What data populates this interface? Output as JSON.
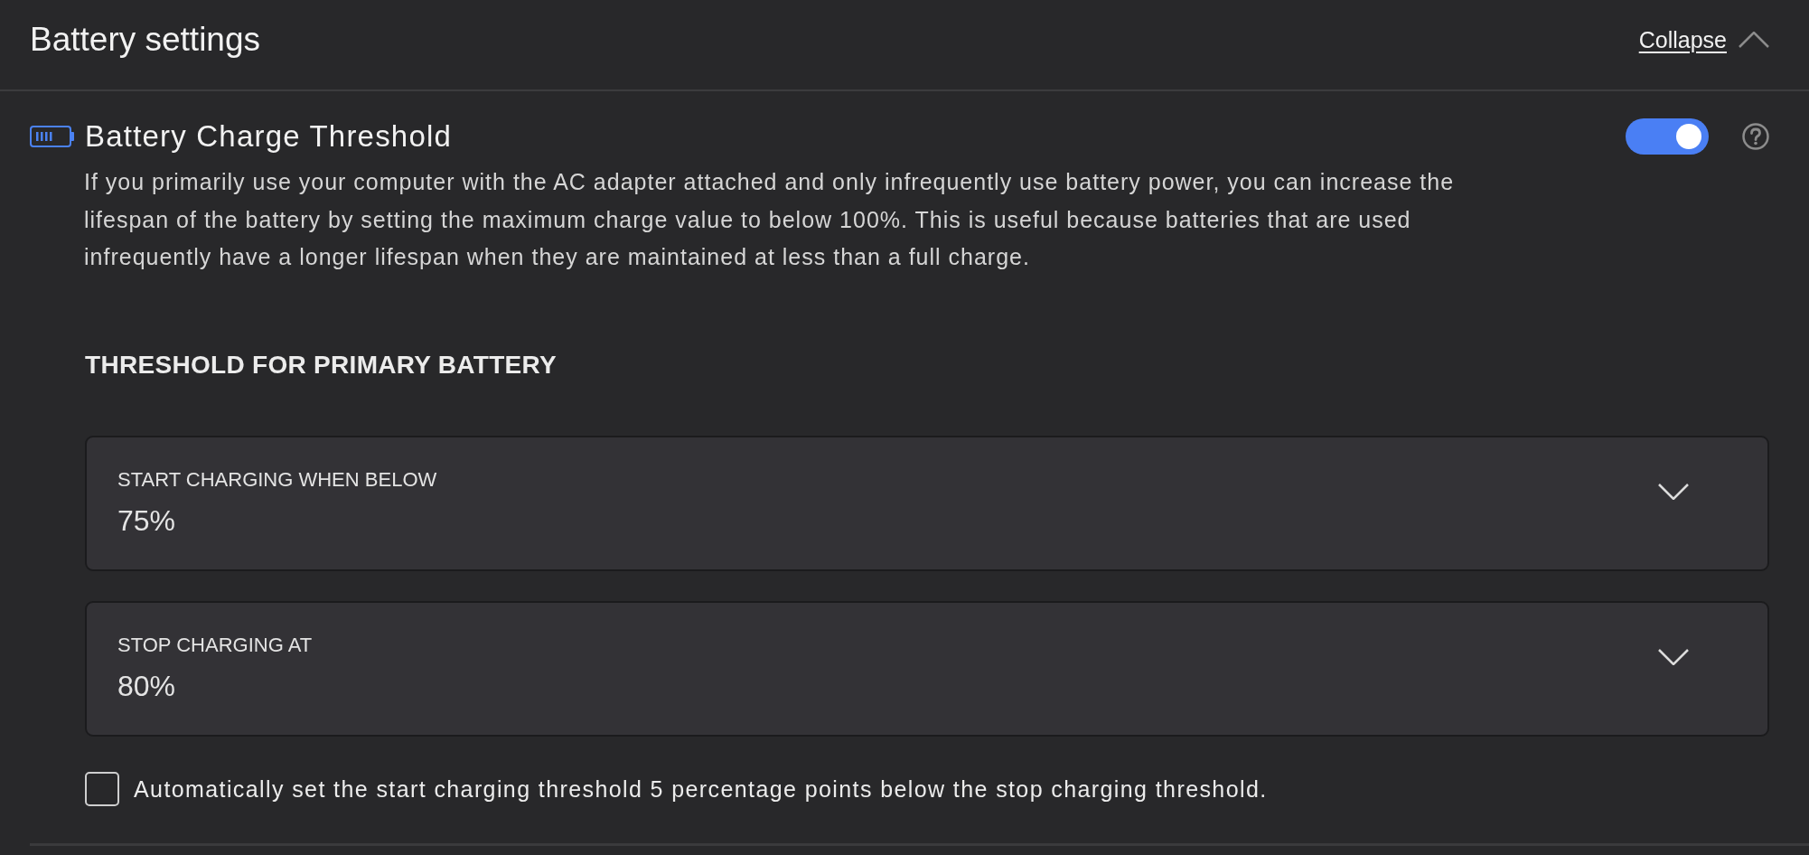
{
  "header": {
    "title": "Battery settings",
    "collapse_link": "Collapse",
    "expanded": true
  },
  "setting": {
    "title": "Battery Charge Threshold",
    "on": true,
    "description": "If you primarily use your computer with the AC adapter attached and only infrequently use battery power, you can increase the lifespan of the battery by setting the maximum charge value to below 100%. This is useful because batteries that are used infrequently have a longer lifespan when they are maintained at less than a full charge."
  },
  "section": {
    "heading": "THRESHOLD FOR PRIMARY BATTERY",
    "dropdowns": [
      {
        "label": "START CHARGING WHEN BELOW",
        "value": "75%"
      },
      {
        "label": "STOP CHARGING AT",
        "value": "80%"
      }
    ],
    "auto_option": {
      "label": "Automatically set the start charging threshold 5 percentage points below the stop charging threshold.",
      "checked": false
    }
  }
}
